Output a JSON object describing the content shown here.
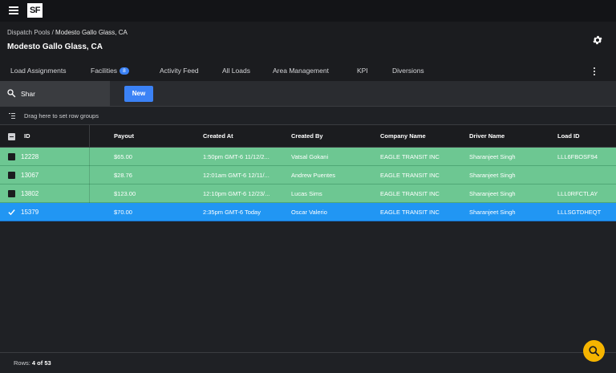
{
  "app": {
    "logo_text": "SF"
  },
  "header": {
    "breadcrumb_root": "Dispatch Pools",
    "breadcrumb_separator": " / ",
    "breadcrumb_current": "Modesto Gallo Glass, CA",
    "title": "Modesto Gallo Glass, CA"
  },
  "tabs": [
    {
      "label": "Load Assignments"
    },
    {
      "label": "Facilities",
      "badge": "8"
    },
    {
      "label": "Activity Feed"
    },
    {
      "label": "All Loads"
    },
    {
      "label": "Area Management"
    },
    {
      "label": "KPI"
    },
    {
      "label": "Diversions"
    }
  ],
  "toolbar": {
    "search_value": "Shar",
    "new_label": "New"
  },
  "grid": {
    "group_hint": "Drag here to set row groups",
    "columns": [
      "ID",
      "Payout",
      "Created At",
      "Created By",
      "Company Name",
      "Driver Name",
      "Load ID"
    ],
    "rows": [
      {
        "id": "12228",
        "payout": "$65.00",
        "created_at": "1:50pm GMT-6 11/12/2...",
        "created_by": "Vatsal Gokani",
        "company": "EAGLE TRANSIT INC",
        "driver": "Sharanjeet Singh",
        "load_id": "LLL6FBOSF94",
        "selected": false
      },
      {
        "id": "13067",
        "payout": "$28.76",
        "created_at": "12:01am GMT-6 12/11/...",
        "created_by": "Andrew Puentes",
        "company": "EAGLE TRANSIT INC",
        "driver": "Sharanjeet Singh",
        "load_id": "",
        "selected": false
      },
      {
        "id": "13802",
        "payout": "$123.00",
        "created_at": "12:10pm GMT-6 12/23/...",
        "created_by": "Lucas Sims",
        "company": "EAGLE TRANSIT INC",
        "driver": "Sharanjeet Singh",
        "load_id": "LLL0RFCTLAY",
        "selected": false
      },
      {
        "id": "15379",
        "payout": "$70.00",
        "created_at": "2:35pm GMT-6 Today",
        "created_by": "Oscar Valerio",
        "company": "EAGLE TRANSIT INC",
        "driver": "Sharanjeet Singh",
        "load_id": "LLLSGTDHEQT",
        "selected": true
      }
    ],
    "footer_label": "Rows: ",
    "footer_value": "4 of 53"
  },
  "colors": {
    "row_green": "#6dc792",
    "row_selected": "#2196f3",
    "accent": "#3b82f6",
    "fab": "#f5b400"
  },
  "icons": [
    "menu-icon",
    "gear-icon",
    "more-vertical-icon",
    "search-icon",
    "row-group-icon",
    "checkbox-icon",
    "check-icon",
    "zoom-search-icon"
  ]
}
